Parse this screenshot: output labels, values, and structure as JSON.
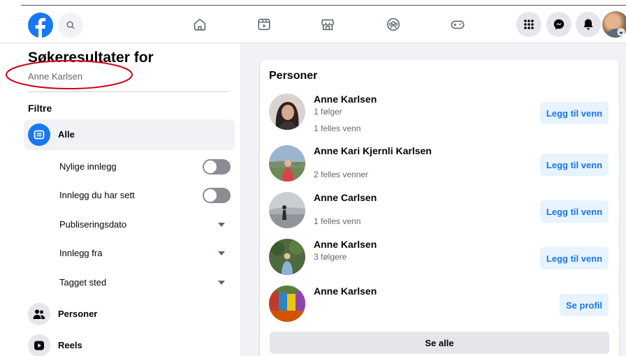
{
  "topbar": {
    "logo_icon": "facebook-logo-icon",
    "nav_icons": [
      "home-icon",
      "watch-icon",
      "marketplace-icon",
      "groups-icon",
      "gaming-icon"
    ],
    "right_icons": [
      "menu-grid-icon",
      "messenger-icon",
      "notifications-bell-icon"
    ],
    "brand_color": "#1877f2"
  },
  "sidebar": {
    "title": "Søkeresultater for",
    "query": "Anne Karlsen",
    "filters_title": "Filtre",
    "all_label": "Alle",
    "filters": [
      {
        "label": "Nylige innlegg",
        "control": "toggle"
      },
      {
        "label": "Innlegg du har sett",
        "control": "toggle"
      },
      {
        "label": "Publiseringsdato",
        "control": "dropdown"
      },
      {
        "label": "Innlegg fra",
        "control": "dropdown"
      },
      {
        "label": "Tagget sted",
        "control": "dropdown"
      }
    ],
    "categories": [
      {
        "label": "Personer",
        "icon": "people-icon"
      },
      {
        "label": "Reels",
        "icon": "reels-icon"
      }
    ],
    "annotation_color": "#d0021b"
  },
  "results": {
    "section_title": "Personer",
    "people": [
      {
        "name": "Anne Karlsen",
        "line1": "1 følger",
        "line2": "1 felles venn",
        "button": "Legg til venn"
      },
      {
        "name": "Anne Kari Kjernli Karlsen",
        "line1": "",
        "line2": "2 felles venner",
        "button": "Legg til venn"
      },
      {
        "name": "Anne Carlsen",
        "line1": "",
        "line2": "1 felles venn",
        "button": "Legg til venn"
      },
      {
        "name": "Anne Karlsen",
        "line1": "3 følgere",
        "line2": "",
        "button": "Legg til venn"
      },
      {
        "name": "Anne Karlsen",
        "line1": "",
        "line2": "",
        "button": "Se profil"
      }
    ],
    "see_all": "Se alle"
  }
}
